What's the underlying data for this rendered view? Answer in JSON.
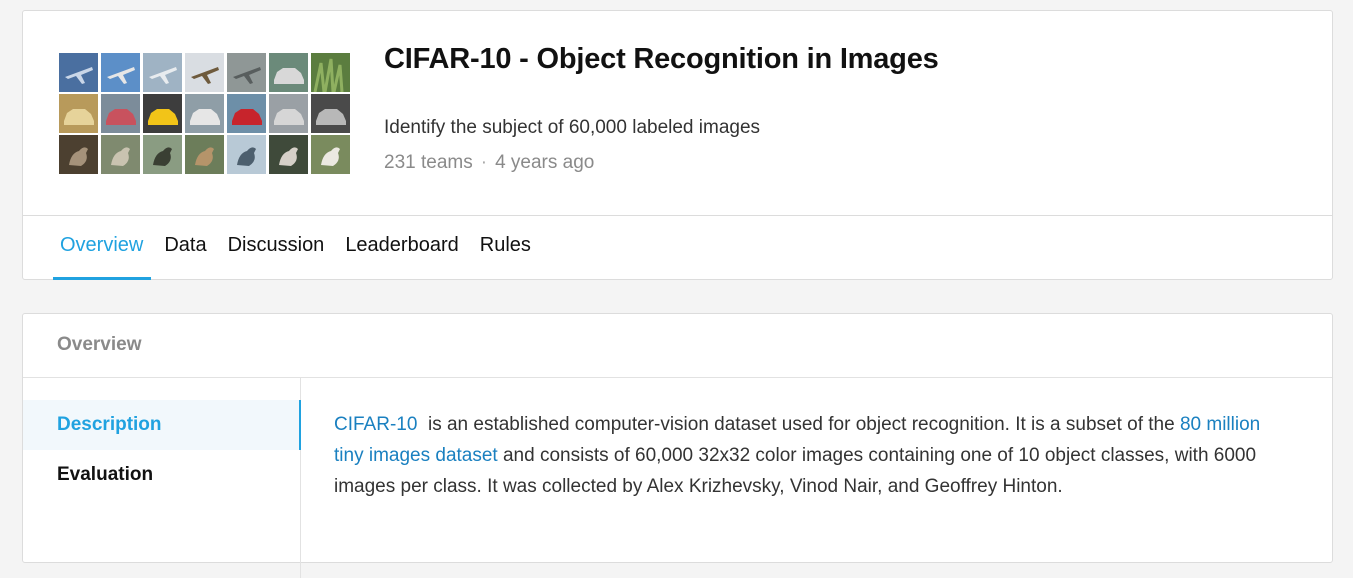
{
  "competition": {
    "title": "CIFAR-10 - Object Recognition in Images",
    "subtitle": "Identify the subject of 60,000 labeled images",
    "teams": "231 teams",
    "separator": "·",
    "age": "4 years ago"
  },
  "thumbnail_grid": {
    "icon": "cifar-sample-images",
    "tiles": [
      {
        "bg": "#4a6fa0",
        "fg": "#c9d6e8"
      },
      {
        "bg": "#5c8fc8",
        "fg": "#e6e6e6"
      },
      {
        "bg": "#9fb3c4",
        "fg": "#e8ecef"
      },
      {
        "bg": "#d9dde2",
        "fg": "#6e5a3c"
      },
      {
        "bg": "#8f9796",
        "fg": "#585e5e"
      },
      {
        "bg": "#6b8a7a",
        "fg": "#d8d8d8"
      },
      {
        "bg": "#5b7d3f",
        "fg": "#8fb060"
      },
      {
        "bg": "#b89a5b",
        "fg": "#e6d39a"
      },
      {
        "bg": "#7c8c9a",
        "fg": "#c8525e"
      },
      {
        "bg": "#3d3d3d",
        "fg": "#f2c418"
      },
      {
        "bg": "#8f9ea7",
        "fg": "#e6e6e6"
      },
      {
        "bg": "#6d8fa8",
        "fg": "#c7242c"
      },
      {
        "bg": "#9aa0a5",
        "fg": "#d6d6d6"
      },
      {
        "bg": "#4a4a4a",
        "fg": "#b8b8b8"
      },
      {
        "bg": "#4c4030",
        "fg": "#a5927a"
      },
      {
        "bg": "#7f8a6f",
        "fg": "#c9c3b0"
      },
      {
        "bg": "#8a9c82",
        "fg": "#3a3f33"
      },
      {
        "bg": "#6c7d5a",
        "fg": "#b5946a"
      },
      {
        "bg": "#b8c9d6",
        "fg": "#4d5f6e"
      },
      {
        "bg": "#3f4a3a",
        "fg": "#d6d0c8"
      },
      {
        "bg": "#7a8b5e",
        "fg": "#ece9e2"
      }
    ]
  },
  "tabs": [
    {
      "label": "Overview",
      "active": true
    },
    {
      "label": "Data",
      "active": false
    },
    {
      "label": "Discussion",
      "active": false
    },
    {
      "label": "Leaderboard",
      "active": false
    },
    {
      "label": "Rules",
      "active": false
    }
  ],
  "overview": {
    "heading": "Overview",
    "side_nav": [
      {
        "label": "Description",
        "active": true
      },
      {
        "label": "Evaluation",
        "active": false
      }
    ],
    "description": {
      "link1": "CIFAR-10",
      "text1": "  is an established computer-vision dataset used for object recognition. It is a subset of the ",
      "link2": "80 million tiny images dataset",
      "text2": " and consists of 60,000 32x32 color images containing one of 10 object classes, with 6000 images per class. It was collected by Alex Krizhevsky, Vinod Nair, and Geoffrey Hinton."
    }
  },
  "colors": {
    "accent": "#20a2e0",
    "link": "#1a80c0",
    "muted": "#8a8a8a"
  }
}
